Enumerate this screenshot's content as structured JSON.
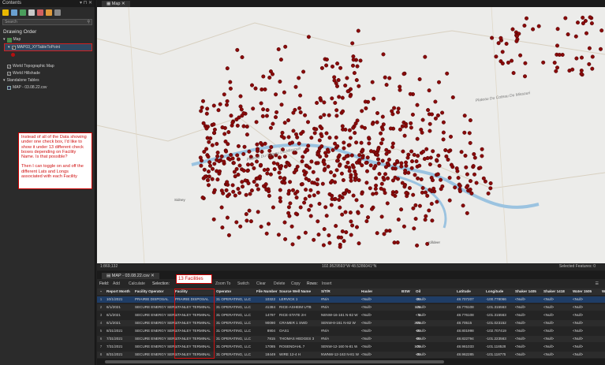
{
  "contents": {
    "title": "Contents",
    "search_placeholder": "Search",
    "drawing_order": "Drawing Order",
    "map_item": "Map",
    "layer_name": "MAP03_XYTableToPoint",
    "topo": "World Topographic Map",
    "hillshade": "World Hillshade",
    "standalone": "Standalone Tables",
    "csv": "MAP - 03.08.22.csv",
    "note_p1": "Instead of all of the Data showing under one check box, I'd like to show it under 13 different check boxes depending on Facility Name. Is that possible?",
    "note_p2": "Then I can toggle on and off the different Lats and Longs associated with each Facility"
  },
  "map": {
    "tab_label": "Map",
    "labels": [
      "Plateau Du Coteau Du Missouri",
      "Plateau Du Coteau Du Missouri",
      "Sidney",
      "Killdeer"
    ],
    "scale": "1:869,132",
    "coords": "102.9529593°W 48.5286041°N",
    "selected": "Selected Features: 0"
  },
  "table": {
    "tab_label": "MAP - 03.08.22.csv",
    "toolbar": [
      "Field:",
      "Add",
      "Calculate",
      "Selection:",
      "Zoom To",
      "Switch",
      "Clear",
      "Delete",
      "Copy",
      "Rows:",
      "Insert"
    ],
    "facility_note": "13 Facilities",
    "columns": [
      "Report Month",
      "Facility Operator",
      "Facility",
      "Operator",
      "File Number",
      "Source Well Name",
      "S/T/R",
      "Hauler",
      "BSW",
      "Oil",
      "Latitude",
      "Longitude",
      "Shaker 1405",
      "Shaker 1418",
      "Water 1505",
      "Wat"
    ],
    "rows": [
      [
        "10/1/2021",
        "PRAIRIE DISPOSAL",
        "PRAIRIE DISPOSAL",
        "31 OPERATING, LLC",
        "10322",
        "LERVICK 1",
        "#N/A",
        "<Null>",
        "30",
        "<Null>",
        "48.707207",
        "-100.778066",
        "<Null>",
        "<Null>",
        "<Null>"
      ],
      [
        "6/1/2021",
        "SECURE ENERGY SER...",
        "STANLEY TERMINAL",
        "31 OPERATING, LLC",
        "41384",
        "RICE-ASHEIM UTB",
        "#N/A",
        "<Null>",
        "115",
        "<Null>",
        "48.776108",
        "-101.315563",
        "<Null>",
        "<Null>",
        "<Null>"
      ],
      [
        "6/1/2021",
        "SECURE ENERGY SER...",
        "STANLEY TERMINAL",
        "31 OPERATING, LLC",
        "14797",
        "RICE-STATE 2H",
        "NENW-16-161 N-82 W",
        "<Null>",
        "5",
        "<Null>",
        "48.776108",
        "-101.315563",
        "<Null>",
        "<Null>",
        "<Null>"
      ],
      [
        "6/1/2021",
        "SECURE ENERGY SER...",
        "STANLEY TERMINAL",
        "31 OPERATING, LLC",
        "90090",
        "CRAMER 1 SWD",
        "SENW-8-161 N-82 W",
        "<Null>",
        "255",
        "<Null>",
        "48.70515",
        "-101.023152",
        "<Null>",
        "<Null>",
        "<Null>"
      ],
      [
        "8/31/2021",
        "SECURE ENERGY SER...",
        "STANLEY TERMINAL",
        "31 OPERATING, LLC",
        "8904",
        "OAS1",
        "#N/A",
        "<Null>",
        "60",
        "<Null>",
        "48.801998",
        "-102.707419",
        "<Null>",
        "<Null>",
        "<Null>"
      ],
      [
        "7/31/2021",
        "SECURE ENERGY SER...",
        "STANLEY TERMINAL",
        "31 OPERATING, LLC",
        "7815",
        "THOMAS HEDGES 3",
        "#N/A",
        "<Null>",
        "80",
        "<Null>",
        "48.822794",
        "-101.223563",
        "<Null>",
        "<Null>",
        "<Null>"
      ],
      [
        "7/31/2021",
        "SECURE ENERGY SER...",
        "STANLEY TERMINAL",
        "31 OPERATING, LLC",
        "17085",
        "ROSENDAHL 7",
        "SENW-12-160 N-81 W",
        "<Null>",
        "100",
        "<Null>",
        "48.961033",
        "-101.118529",
        "<Null>",
        "<Null>",
        "<Null>"
      ],
      [
        "8/31/2021",
        "SECURE ENERGY SER...",
        "STANLEY TERMINAL",
        "31 OPERATING, LLC",
        "18449",
        "WIRE 12-4 H",
        "NWNW-12-163 N-81 W",
        "<Null>",
        "40",
        "<Null>",
        "48.962285",
        "-101.118775",
        "<Null>",
        "<Null>",
        "<Null>"
      ]
    ]
  }
}
